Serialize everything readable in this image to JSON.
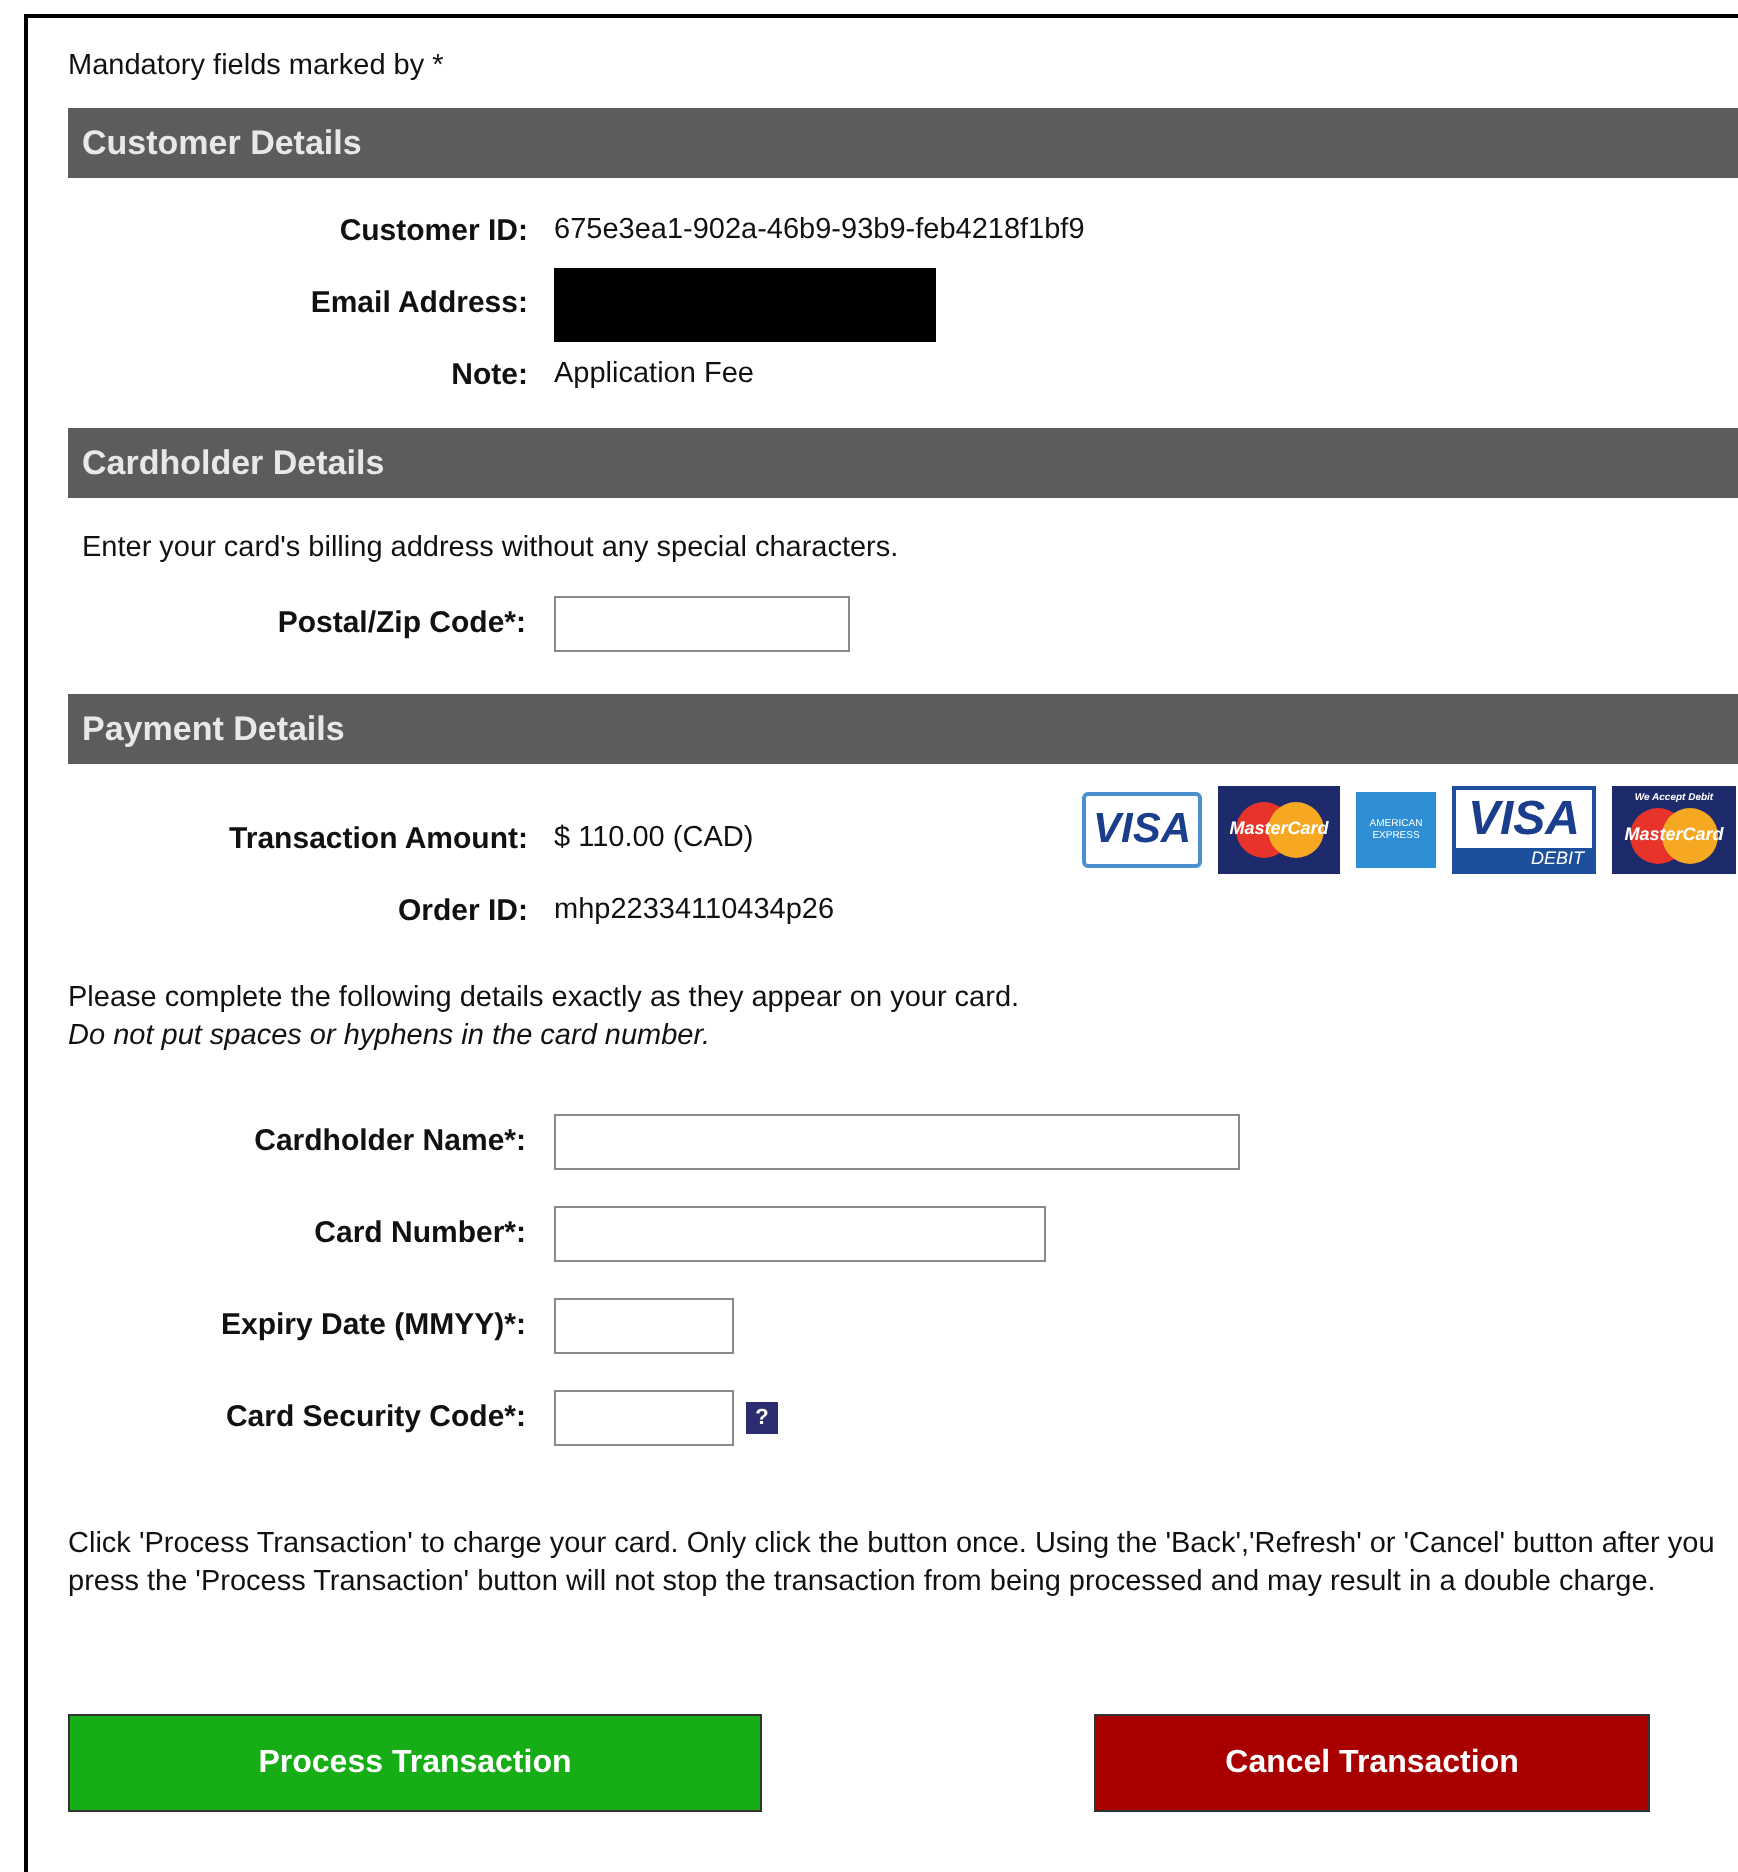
{
  "mandatory_note": "Mandatory fields marked by *",
  "sections": [
    {
      "title": "Customer Details"
    },
    {
      "title": "Cardholder Details"
    },
    {
      "title": "Payment Details"
    }
  ],
  "customer": [
    {
      "label": "Customer ID:",
      "value": "675e3ea1-902a-46b9-93b9-feb4218f1bf9",
      "redacted": false
    },
    {
      "label": "Email Address:",
      "redacted": true
    },
    {
      "label": "Note:",
      "value": "Application Fee",
      "redacted": false
    }
  ],
  "cardholder": {
    "instruction": "Enter your card's billing address without any special characters.",
    "fields": [
      {
        "label": "Postal/Zip Code*:",
        "help": false
      }
    ]
  },
  "payment": {
    "info": [
      {
        "label": "Transaction Amount:",
        "value": "$ 110.00 (CAD)"
      },
      {
        "label": "Order ID:",
        "value": "mhp22334110434p26"
      }
    ],
    "card_logos": [
      {
        "kind": "visa",
        "text": "VISA"
      },
      {
        "kind": "mastercard",
        "text": "MasterCard"
      },
      {
        "kind": "amex",
        "text": "AMERICAN EXPRESS"
      },
      {
        "kind": "visa_debit",
        "text": "VISA",
        "subtext": "DEBIT"
      },
      {
        "kind": "mastercard_debit",
        "text": "MasterCard",
        "subtext": "We Accept Debit"
      }
    ],
    "instruction": "Please complete the following details exactly as they appear on your card.",
    "instruction_note": "Do not put spaces or hyphens in the card number.",
    "fields": [
      {
        "label": "Cardholder Name*:",
        "help": false
      },
      {
        "label": "Card Number*:",
        "help": false
      },
      {
        "label": "Expiry Date (MMYY)*:",
        "help": false
      },
      {
        "label": "Card Security Code*:",
        "help": true,
        "help_text": "?"
      }
    ]
  },
  "warning": "Click 'Process Transaction' to charge your card. Only click the button once. Using the 'Back','Refresh' or 'Cancel' button after you press the 'Process Transaction' button will not stop the transaction from being processed and may result in a double charge.",
  "buttons": [
    {
      "label": "Process Transaction",
      "kind": "primary"
    },
    {
      "label": "Cancel Transaction",
      "kind": "danger"
    }
  ]
}
